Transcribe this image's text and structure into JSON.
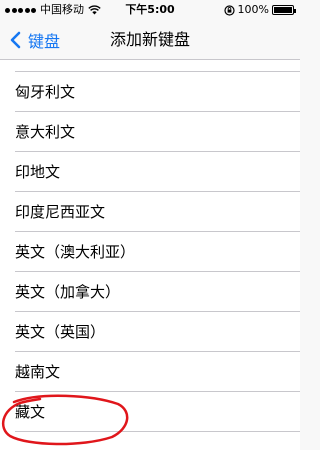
{
  "status_bar": {
    "carrier": "中国移动",
    "wifi_icon": "wifi-icon",
    "time": "下午5:00",
    "lock_icon": "orientation-lock-icon",
    "battery_percent": "100%",
    "battery_level": 1.0
  },
  "nav": {
    "back_label": "键盘",
    "back_icon": "chevron-left-icon",
    "title": "添加新键盘"
  },
  "languages": [
    "匈牙利文",
    "意大利文",
    "印地文",
    "印度尼西亚文",
    "英文（澳大利亚）",
    "英文（加拿大）",
    "英文（英国）",
    "越南文",
    "藏文"
  ],
  "annotation": {
    "color": "#e0161b",
    "circled_item": "藏文"
  }
}
